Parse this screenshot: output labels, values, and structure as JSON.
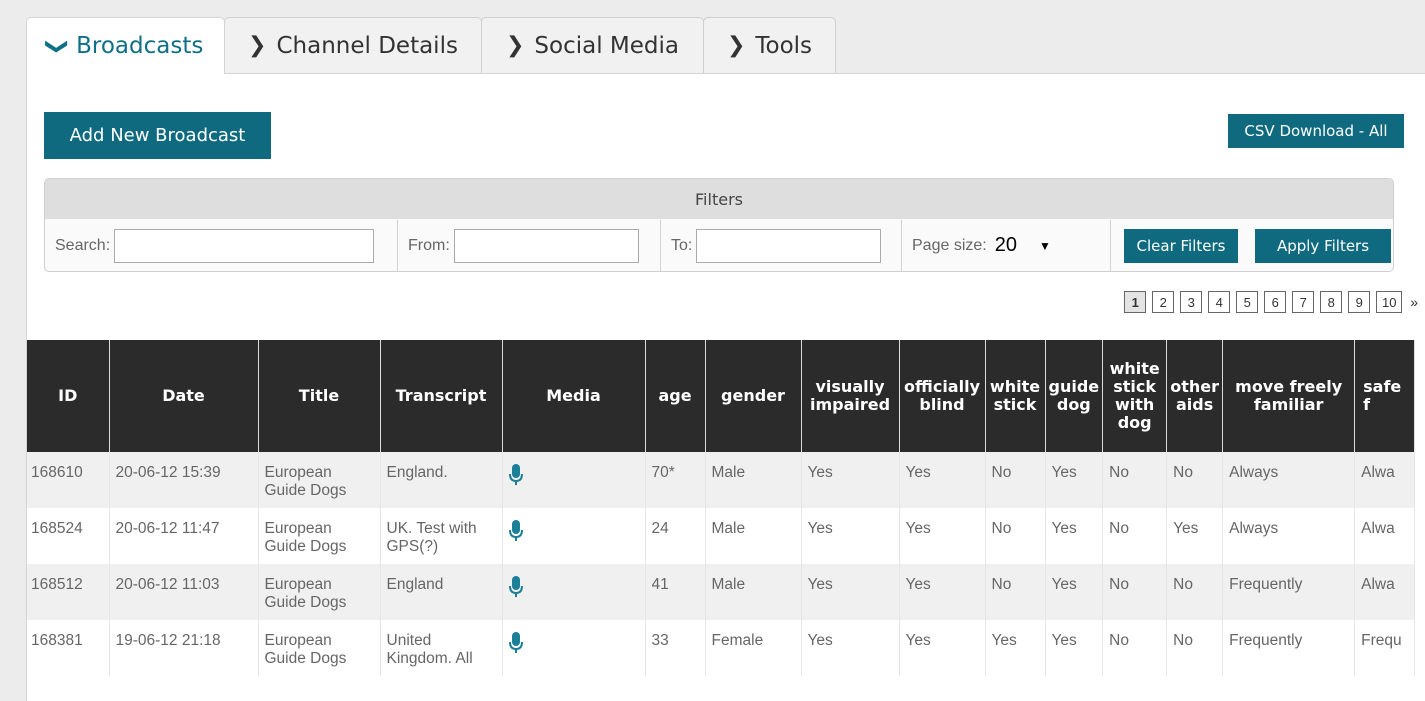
{
  "tabs": [
    {
      "label": "Broadcasts",
      "active": true
    },
    {
      "label": "Channel Details",
      "active": false
    },
    {
      "label": "Social Media",
      "active": false
    },
    {
      "label": "Tools",
      "active": false
    }
  ],
  "toolbar": {
    "add_label": "Add New Broadcast",
    "csv_label": "CSV Download - All"
  },
  "filters": {
    "title": "Filters",
    "search_label": "Search:",
    "search_value": "",
    "from_label": "From:",
    "from_value": "",
    "to_label": "To:",
    "to_value": "",
    "pagesize_label": "Page size:",
    "pagesize_value": "20",
    "clear_label": "Clear Filters",
    "apply_label": "Apply Filters"
  },
  "pager": {
    "pages": [
      "1",
      "2",
      "3",
      "4",
      "5",
      "6",
      "7",
      "8",
      "9",
      "10"
    ],
    "current": "1",
    "next": "»"
  },
  "table": {
    "headers": [
      "ID",
      "Date",
      "Title",
      "Transcript",
      "Media",
      "age",
      "gender",
      "visually impaired",
      "officially blind",
      "white stick",
      "guide dog",
      "white stick with dog",
      "other aids",
      "move freely familiar",
      "safe f"
    ],
    "rows": [
      {
        "id": "168610",
        "date": "20-06-12 15:39",
        "title": "European Guide Dogs",
        "transcript": "England.",
        "media": "mic-icon",
        "age": "70*",
        "gender": "Male",
        "visually_impaired": "Yes",
        "officially_blind": "Yes",
        "white_stick": "No",
        "guide_dog": "Yes",
        "stick_with_dog": "No",
        "other_aids": "No",
        "move_freely": "Always",
        "safe": "Alwa"
      },
      {
        "id": "168524",
        "date": "20-06-12 11:47",
        "title": "European Guide Dogs",
        "transcript": "UK. Test with GPS(?)",
        "media": "mic-icon",
        "age": "24",
        "gender": "Male",
        "visually_impaired": "Yes",
        "officially_blind": "Yes",
        "white_stick": "No",
        "guide_dog": "Yes",
        "stick_with_dog": "No",
        "other_aids": "Yes",
        "move_freely": "Always",
        "safe": "Alwa"
      },
      {
        "id": "168512",
        "date": "20-06-12 11:03",
        "title": "European Guide Dogs",
        "transcript": "England",
        "media": "mic-icon",
        "age": "41",
        "gender": "Male",
        "visually_impaired": "Yes",
        "officially_blind": "Yes",
        "white_stick": "No",
        "guide_dog": "Yes",
        "stick_with_dog": "No",
        "other_aids": "No",
        "move_freely": "Frequently",
        "safe": "Alwa"
      },
      {
        "id": "168381",
        "date": "19-06-12 21:18",
        "title": "European Guide Dogs",
        "transcript": "United Kingdom. All",
        "media": "mic-icon",
        "age": "33",
        "gender": "Female",
        "visually_impaired": "Yes",
        "officially_blind": "Yes",
        "white_stick": "Yes",
        "guide_dog": "Yes",
        "stick_with_dog": "No",
        "other_aids": "No",
        "move_freely": "Frequently",
        "safe": "Frequ"
      }
    ]
  },
  "colors": {
    "accent": "#0f6a80",
    "header_bg": "#2b2b2b",
    "tab_active_text": "#0e6f86"
  }
}
